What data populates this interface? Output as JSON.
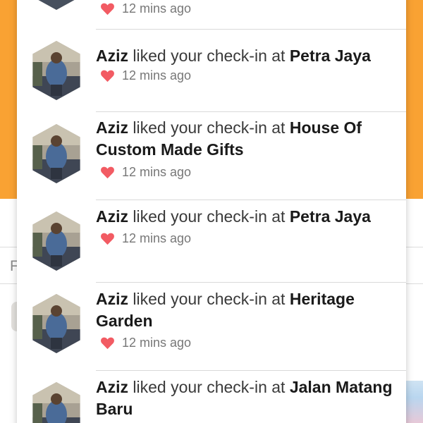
{
  "background": {
    "partial_letter": "F"
  },
  "notifications": [
    {
      "time": "12 mins ago"
    },
    {
      "name": "Aziz",
      "verb": "liked your check-in at",
      "place": "Petra Jaya",
      "time": "12 mins ago"
    },
    {
      "name": "Aziz",
      "verb": "liked your check-in at",
      "place": "House Of Custom Made Gifts",
      "time": "12 mins ago"
    },
    {
      "name": "Aziz",
      "verb": "liked your check-in at",
      "place": "Petra Jaya",
      "time": "12 mins ago"
    },
    {
      "name": "Aziz",
      "verb": "liked your check-in at",
      "place": "Heritage Garden",
      "time": "12 mins ago"
    },
    {
      "name": "Aziz",
      "verb": "liked your check-in at",
      "place": "Jalan Matang Baru"
    }
  ],
  "colors": {
    "accent_orange": "#f9a233",
    "heart_red": "#f25b63",
    "text_primary": "#1a1a1a",
    "text_meta": "#777777"
  },
  "icons": {
    "like": "heart-icon",
    "avatar": "user-avatar-hexagon"
  }
}
